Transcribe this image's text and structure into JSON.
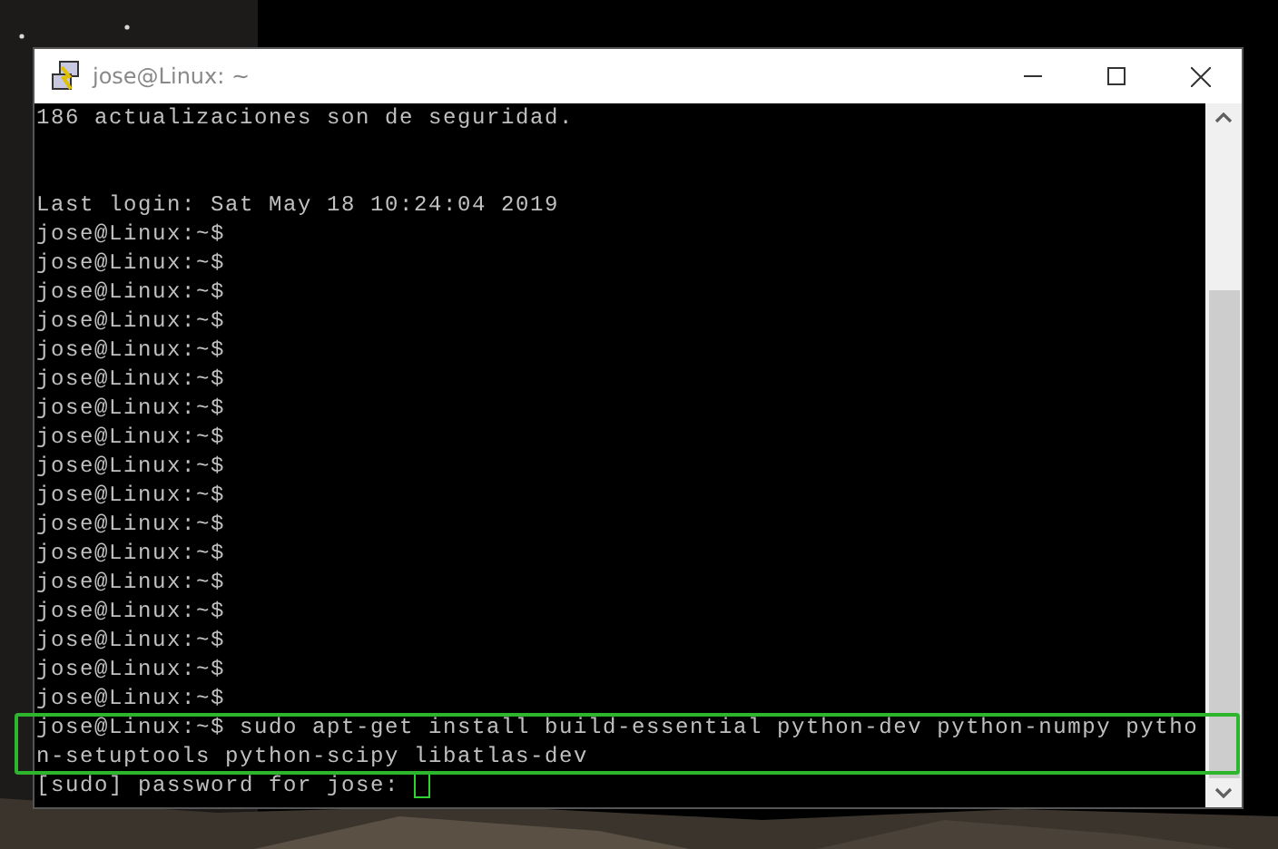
{
  "window": {
    "title": "jose@Linux: ~"
  },
  "terminal": {
    "lines": [
      {
        "kind": "text",
        "text": "186 actualizaciones son de seguridad."
      },
      {
        "kind": "blank"
      },
      {
        "kind": "blank"
      },
      {
        "kind": "text",
        "text": "Last login: Sat May 18 10:24:04 2019"
      },
      {
        "kind": "text",
        "text": "jose@Linux:~$"
      },
      {
        "kind": "text",
        "text": "jose@Linux:~$"
      },
      {
        "kind": "text",
        "text": "jose@Linux:~$"
      },
      {
        "kind": "text",
        "text": "jose@Linux:~$"
      },
      {
        "kind": "text",
        "text": "jose@Linux:~$"
      },
      {
        "kind": "text",
        "text": "jose@Linux:~$"
      },
      {
        "kind": "text",
        "text": "jose@Linux:~$"
      },
      {
        "kind": "text",
        "text": "jose@Linux:~$"
      },
      {
        "kind": "text",
        "text": "jose@Linux:~$"
      },
      {
        "kind": "text",
        "text": "jose@Linux:~$"
      },
      {
        "kind": "text",
        "text": "jose@Linux:~$"
      },
      {
        "kind": "text",
        "text": "jose@Linux:~$"
      },
      {
        "kind": "text",
        "text": "jose@Linux:~$"
      },
      {
        "kind": "text",
        "text": "jose@Linux:~$"
      },
      {
        "kind": "text",
        "text": "jose@Linux:~$"
      },
      {
        "kind": "text",
        "text": "jose@Linux:~$"
      },
      {
        "kind": "text",
        "text": "jose@Linux:~$"
      },
      {
        "kind": "text",
        "text": "jose@Linux:~$ sudo apt-get install build-essential python-dev python-numpy pytho"
      },
      {
        "kind": "text",
        "text": "n-setuptools python-scipy libatlas-dev"
      },
      {
        "kind": "text",
        "text": "[sudo] password for jose:",
        "cursor": true
      }
    ]
  }
}
